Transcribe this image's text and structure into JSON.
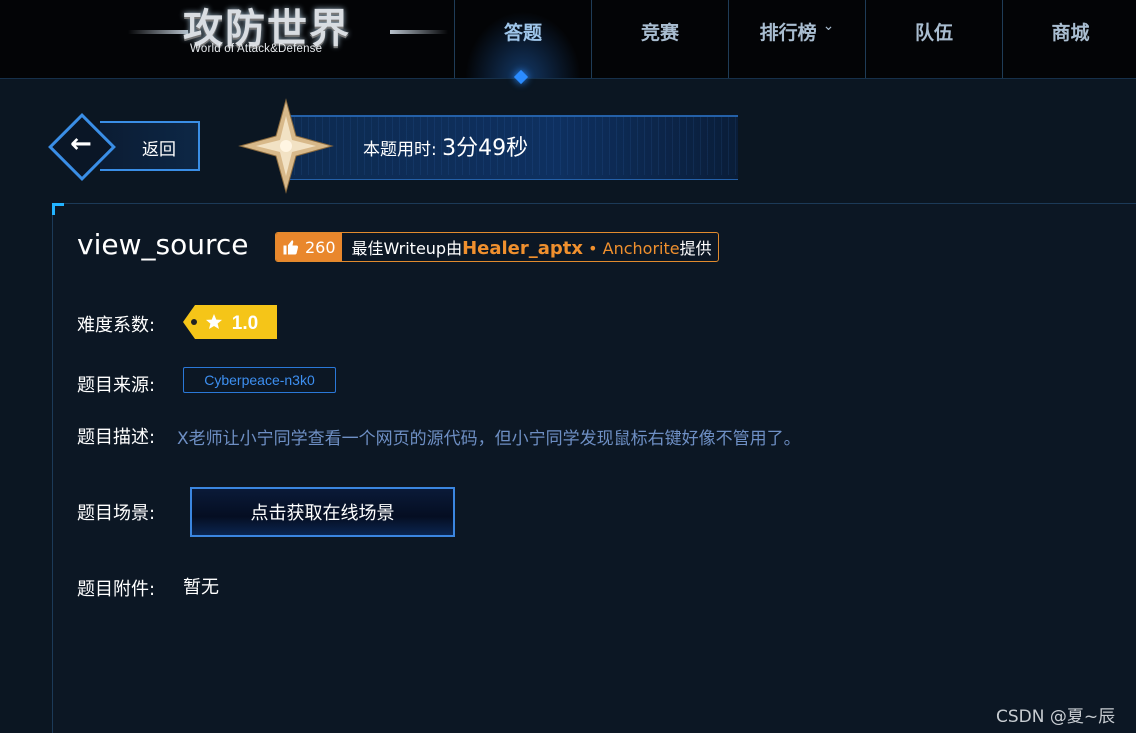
{
  "header": {
    "logo_title": "攻防世界",
    "logo_subtitle": "World of Attack&Defense",
    "nav": [
      {
        "label": "答题"
      },
      {
        "label": "竞赛"
      },
      {
        "label": "排行榜"
      },
      {
        "label": "队伍"
      },
      {
        "label": "商城"
      }
    ],
    "active_nav": "答题"
  },
  "back_label": "返回",
  "timer": {
    "label": "本题用时:",
    "value": "3分49秒"
  },
  "challenge": {
    "title": "view_source",
    "likes": "260",
    "writeup_prefix": "最佳Writeup由",
    "writeup_user": "Healer_aptx",
    "writeup_team": " • Anchorite",
    "writeup_suffix": "提供",
    "difficulty_label": "难度系数:",
    "difficulty_value": "1.0",
    "source_label": "题目来源:",
    "source_value": "Cyberpeace-n3k0",
    "desc_label": "题目描述:",
    "desc_value": "X老师让小宁同学查看一个网页的源代码，但小宁同学发现鼠标右键好像不管用了。",
    "scene_label": "题目场景:",
    "scene_button": "点击获取在线场景",
    "attach_label": "题目附件:",
    "attach_value": "暂无"
  },
  "watermark": "CSDN @夏~辰",
  "colors": {
    "accent": "#3a8ee6",
    "orange": "#e9872c",
    "gold": "#f5c518",
    "background": "#0b1622"
  }
}
